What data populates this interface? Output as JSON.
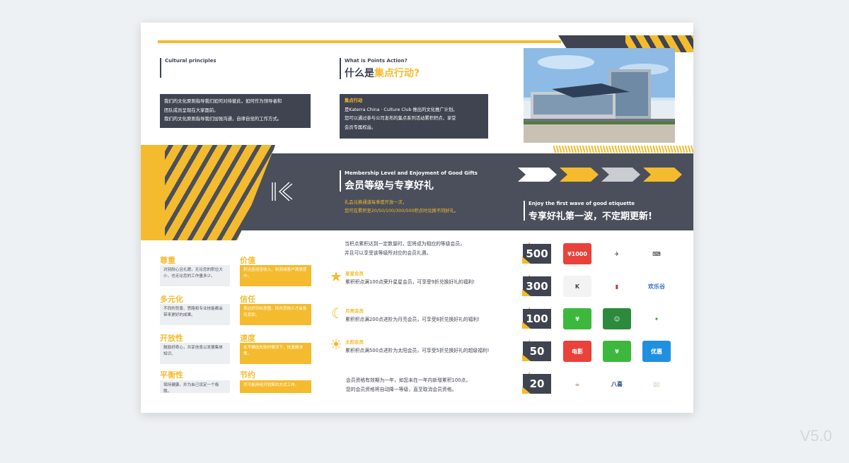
{
  "left": {
    "small_heading": "Cultural principles",
    "intro_lines": [
      "我们的文化原则指导我们如何对待彼此，如何作为领导者和",
      "团队成员呈现在大家面前。",
      "我们的文化原则指导我们加强沟通，自律自觉的工作方式。"
    ]
  },
  "points": {
    "small_heading": "What is Points Action?",
    "title_prefix": "什么是",
    "title_highlight": "集点行动?",
    "box_label": "集点行动",
    "box_lines": [
      "是Katerra China · Culture Club 推出的文化推广计划。",
      "您可以通过参与公司发布的集点系列活动累积积点，享受",
      "会员专属权益。"
    ]
  },
  "membership": {
    "small_heading": "Membership Level and Enjoyment of Good Gifts",
    "title": "会员等级与专享好礼",
    "note_lines": [
      "礼品兑换通道每季度开放一次，",
      "您可在累积至20/50/100/300/500积点时兑换不同好礼。"
    ]
  },
  "gifts_heading": {
    "small_heading": "Enjoy the first wave of good etiquette",
    "title": "专享好礼第一波，不定期更新!"
  },
  "values": [
    {
      "title": "尊重",
      "text": "对别耐心且礼貌，无论您的职位大小，也无论您的工作量多少。",
      "style": "grey"
    },
    {
      "title": "价值",
      "text": "积达各加至收入，利润或客户满意度中。",
      "style": "yellow"
    },
    {
      "title": "多元化",
      "text": "不同的背景、思路和专业技能都会带来更好的成果。",
      "style": "grey"
    },
    {
      "title": "信任",
      "text": "表达好目标意图，即并其他人才会各司其职。",
      "style": "yellow"
    },
    {
      "title": "开放性",
      "text": "鼓励好奇心，共享信息以发展集体知识。",
      "style": "grey"
    },
    {
      "title": "速度",
      "text": "在不确信失败的情况下，快速做决策。",
      "style": "yellow"
    },
    {
      "title": "平衡性",
      "text": "保持健康，并为自己设定一个极限。",
      "style": "grey"
    },
    {
      "title": "节约",
      "text": "尽可能用经济划算的方式工作。",
      "style": "yellow"
    }
  ],
  "tiers_intro": [
    "当积点累积达到一定数量时，您将成为相应的等级会员，",
    "并且可以享受该等级所对应的会员礼遇。"
  ],
  "tiers": [
    {
      "name": "星星会员",
      "text": "累积积点满100点荣升星星会员，可享受9折兑换好礼的福利!",
      "icon": "star-icon",
      "glyph": "★"
    },
    {
      "name": "月亮会员",
      "text": "累积积点满200点进阶为月亮会员，可享受8折兑换好礼的福利!",
      "icon": "moon-icon",
      "glyph": "☾"
    },
    {
      "name": "太阳会员",
      "text": "累积积点满500点进阶为太阳会员，可享受5折兑换好礼的超级福利!",
      "icon": "sun-icon",
      "glyph": "☀"
    }
  ],
  "validity": [
    "会员资格有效期为一年，如您未在一年内新增累积100点，",
    "您的会员资格将自动降一等级，直至取消会员资格。"
  ],
  "gift_rows": [
    {
      "points": "500",
      "items": [
        {
          "name": "gift-card",
          "label": "¥1000",
          "bg": "#e8423a",
          "fg": "#ffffff"
        },
        {
          "name": "drone",
          "label": "✈",
          "bg": "#ffffff",
          "fg": "#333333"
        },
        {
          "name": "keyboard",
          "label": "⌨",
          "bg": "#ffffff",
          "fg": "#222222"
        }
      ]
    },
    {
      "points": "300",
      "items": [
        {
          "name": "katerra-logo",
          "label": "K",
          "bg": "#f3f3f3",
          "fg": "#3f4450"
        },
        {
          "name": "lipstick",
          "label": "▮",
          "bg": "#ffffff",
          "fg": "#c0392b"
        },
        {
          "name": "happy-valley",
          "label": "欢乐谷",
          "bg": "#ffffff",
          "fg": "#2e6fc4"
        }
      ]
    },
    {
      "points": "100",
      "items": [
        {
          "name": "wechat-card",
          "label": "¥",
          "bg": "#3cb83c",
          "fg": "#ffffff"
        },
        {
          "name": "green-app",
          "label": "☺",
          "bg": "#2c8a3c",
          "fg": "#ffffff"
        },
        {
          "name": "sports-logo",
          "label": "✦",
          "bg": "#ffffff",
          "fg": "#3a9a3a"
        }
      ]
    },
    {
      "points": "50",
      "items": [
        {
          "name": "meituan",
          "label": "电影",
          "bg": "#e8423a",
          "fg": "#ffffff"
        },
        {
          "name": "wechat-card-small",
          "label": "¥",
          "bg": "#3cb83c",
          "fg": "#ffffff"
        },
        {
          "name": "coupon-app",
          "label": "优惠",
          "bg": "#1f8fe0",
          "fg": "#ffffff"
        }
      ]
    },
    {
      "points": "20",
      "items": [
        {
          "name": "milk-tea",
          "label": "☕",
          "bg": "#ffffff",
          "fg": "#8a5a2b"
        },
        {
          "name": "baxi-logo",
          "label": "八喜",
          "bg": "#ffffff",
          "fg": "#1c3f9a"
        },
        {
          "name": "tubes",
          "label": "▯▯",
          "bg": "#ffffff",
          "fg": "#c7a56d"
        }
      ]
    }
  ],
  "version": "V5.0",
  "colors": {
    "accent": "#f4bb2e",
    "dark": "#3f4450"
  }
}
